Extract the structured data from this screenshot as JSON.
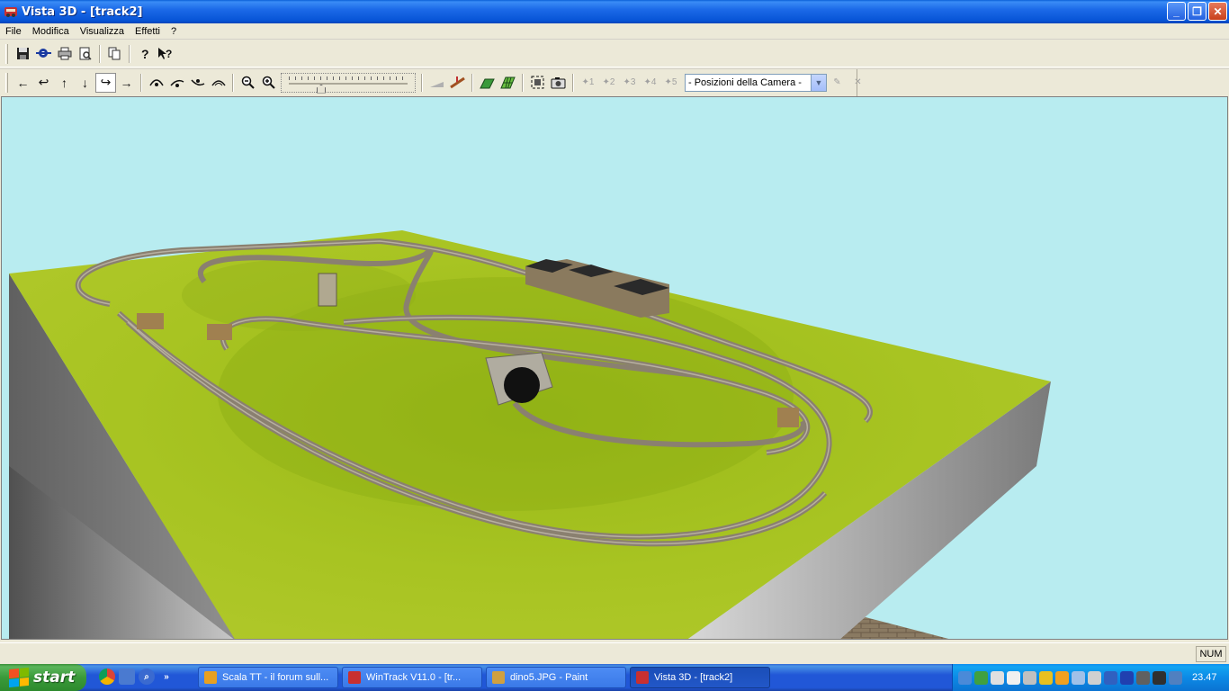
{
  "window": {
    "title": "Vista 3D - [track2]",
    "controls": {
      "minimize": "_",
      "maximize": "❐",
      "close": "✕"
    }
  },
  "menu": [
    "File",
    "Modifica",
    "Visualizza",
    "Effetti",
    "?"
  ],
  "toolbar1": {
    "icons": [
      "save-icon",
      "camera-settings-icon",
      "print-icon",
      "print-preview-icon",
      "copy-icon",
      "help-icon",
      "context-help-icon"
    ]
  },
  "toolbar2": {
    "nav_icons": [
      "arrow-left-icon",
      "arrow-turn-left-icon",
      "arrow-up-icon",
      "arrow-down-icon",
      "arrow-turn-right-icon",
      "arrow-right-icon"
    ],
    "zoom_slider_level": 0.25,
    "camera_presets": [
      "1",
      "2",
      "3",
      "4",
      "5"
    ],
    "camera_select": {
      "value": "- Posizioni della Camera -"
    }
  },
  "statusbar": {
    "num_indicator": "NUM"
  },
  "taskbar": {
    "start_label": "start",
    "tasks": [
      {
        "label": "Scala TT - il forum sull...",
        "icon_color": "#e8a020",
        "active": false
      },
      {
        "label": "WinTrack  V11.0 - [tr...",
        "icon_color": "#c83030",
        "active": false
      },
      {
        "label": "dino5.JPG - Paint",
        "icon_color": "#d0a040",
        "active": false
      },
      {
        "label": "Vista 3D - [track2]",
        "icon_color": "#c83030",
        "active": true
      }
    ],
    "clock": "23.47"
  },
  "colors": {
    "sky": "#b8ecf0",
    "terrain": "#a8c020",
    "terrain_dark": "#80a010",
    "track": "#8a8070",
    "board_side": "#909090"
  }
}
